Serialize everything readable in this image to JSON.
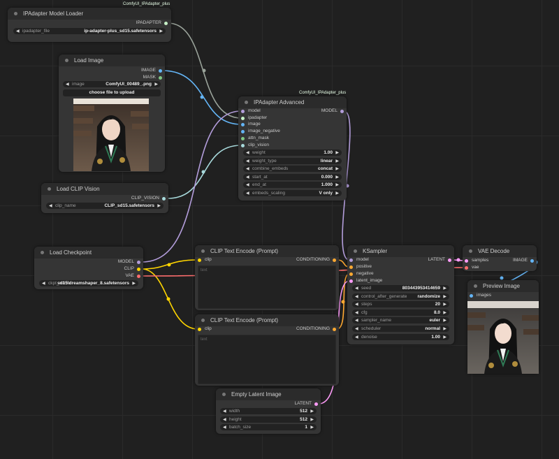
{
  "colors": {
    "model": "#b39ddb",
    "clip": "#ffd500",
    "vae": "#ff6e6e",
    "conditioning": "#ffa931",
    "latent": "#ff9cf9",
    "image": "#64b5f6",
    "mask": "#81c784",
    "ipadapter": "#ffffff",
    "clip_vision": "#a8dadc"
  },
  "nodes": {
    "ipadapter_loader": {
      "badge": "ComfyUI_IPAdapter_plus",
      "title": "IPAdapter Model Loader",
      "output": "IPADAPTER",
      "widget_label": "ipadapter_file",
      "widget_value": "ip-adapter-plus_sd15.safetensors"
    },
    "load_image": {
      "title": "Load Image",
      "out_image": "IMAGE",
      "out_mask": "MASK",
      "widget_label": "image",
      "widget_value": "ComfyUI_00489_.png",
      "button": "choose file to upload"
    },
    "ipadapter_adv": {
      "badge": "ComfyUI_IPAdapter_plus",
      "title": "IPAdapter Advanced",
      "inputs": [
        "model",
        "ipadapter",
        "image",
        "image_negative",
        "attn_mask",
        "clip_vision"
      ],
      "output": "MODEL",
      "widgets": [
        {
          "label": "weight",
          "value": "1.00"
        },
        {
          "label": "weight_type",
          "value": "linear"
        },
        {
          "label": "combine_embeds",
          "value": "concat"
        },
        {
          "label": "start_at",
          "value": "0.000"
        },
        {
          "label": "end_at",
          "value": "1.000"
        },
        {
          "label": "embeds_scaling",
          "value": "V only"
        }
      ]
    },
    "load_clip_vision": {
      "title": "Load CLIP Vision",
      "output": "CLIP_VISION",
      "widget_label": "clip_name",
      "widget_value": "CLIP_sd15.safetensors"
    },
    "load_checkpoint": {
      "title": "Load Checkpoint",
      "outputs": [
        "MODEL",
        "CLIP",
        "VAE"
      ],
      "widget_label": "ckpt_name",
      "widget_value": "sd15\\dreamshaper_8.safetensors"
    },
    "clip_text_1": {
      "title": "CLIP Text Encode (Prompt)",
      "input": "clip",
      "output": "CONDITIONING",
      "placeholder": "text"
    },
    "clip_text_2": {
      "title": "CLIP Text Encode (Prompt)",
      "input": "clip",
      "output": "CONDITIONING",
      "placeholder": "text"
    },
    "ksampler": {
      "title": "KSampler",
      "inputs": [
        "model",
        "positive",
        "negative",
        "latent_image"
      ],
      "output": "LATENT",
      "widgets": [
        {
          "label": "seed",
          "value": "803443953414659"
        },
        {
          "label": "control_after_generate",
          "value": "randomize"
        },
        {
          "label": "steps",
          "value": "20"
        },
        {
          "label": "cfg",
          "value": "8.0"
        },
        {
          "label": "sampler_name",
          "value": "euler"
        },
        {
          "label": "scheduler",
          "value": "normal"
        },
        {
          "label": "denoise",
          "value": "1.00"
        }
      ]
    },
    "vae_decode": {
      "title": "VAE Decode",
      "inputs": [
        "samples",
        "vae"
      ],
      "output": "IMAGE"
    },
    "preview_image": {
      "title": "Preview Image",
      "input": "images"
    },
    "empty_latent": {
      "title": "Empty Latent Image",
      "output": "LATENT",
      "widgets": [
        {
          "label": "width",
          "value": "512"
        },
        {
          "label": "height",
          "value": "512"
        },
        {
          "label": "batch_size",
          "value": "1"
        }
      ]
    }
  }
}
